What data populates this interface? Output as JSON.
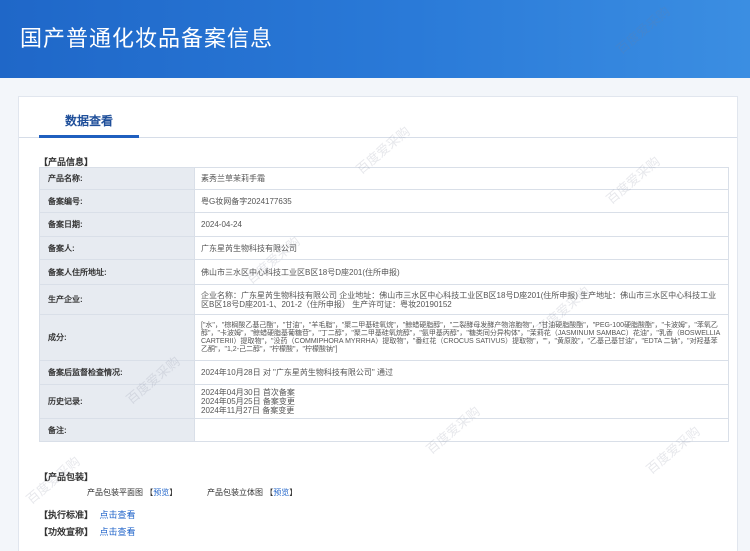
{
  "header": {
    "title": "国产普通化妆品备案信息"
  },
  "tabs": [
    {
      "label": "数据查看"
    }
  ],
  "product_info": {
    "section_label": "【产品信息】",
    "rows": [
      {
        "key": "产品名称:",
        "value": "素秀兰草茉莉手霜"
      },
      {
        "key": "备案编号:",
        "value": "粤G妆网备字2024177635"
      },
      {
        "key": "备案日期:",
        "value": "2024-04-24"
      },
      {
        "key": "备案人:",
        "value": "广东星芮生物科技有限公司"
      },
      {
        "key": "备案人住所地址:",
        "value": "佛山市三水区中心科技工业区B区18号D座201(住所申报)"
      },
      {
        "key": "生产企业:",
        "value": "企业名称：广东星芮生物科技有限公司 企业地址：佛山市三水区中心科技工业区B区18号D座201(住所申报) 生产地址：佛山市三水区中心科技工业区B区18号D座201-1、201-2（住所申报） 生产许可证：粤妆20190152"
      },
      {
        "key": "成分:",
        "value": "[\"水\"，\"棕榈酸乙基己酯\"，\"甘油\"，\"羊毛脂\"，\"聚二甲基硅氧烷\"，\"鲸蜡硬脂醇\"，\"二裂酵母发酵产物溶胞物\"，\"甘油硬脂酸酯\"，\"PEG-100硬脂酸酯\"，\"卡波姆\"，\"苯氧乙醇\"，\"卡波姆\"，\"鲸蜡硬脂基葡糖苷\"，\"丁二醇\"，\"聚二甲基硅氧烷醇\"，\"氨甲基丙醇\"，\"糖类同分异构体\"，\"茉莉花（JASMINUM SAMBAC）花油\"，\"乳香（BOSWELLIA CARTERII）提取物\"，\"没药（COMMIPHORA MYRRHA）提取物\"，\"番红花（CROCUS SATIVUS）提取物\"，\"\"，\"黄原胶\"，\"乙基己基甘油\"，\"EDTA 二钠\"，\"对羟基苯乙酮\"，\"1,2-己二醇\"，\"柠檬酸\"，\"柠檬酸钠\"]"
      },
      {
        "key": "备案后监督检查情况:",
        "value": "2024年10月28日 对 \"广东星芮生物科技有限公司\" 通过"
      },
      {
        "key": "历史记录:",
        "lines": [
          "2024年04月30日 首次备案",
          "2024年05月25日 备案变更",
          "2024年11月27日 备案变更"
        ]
      },
      {
        "key": "备注:",
        "value": ""
      }
    ]
  },
  "packaging": {
    "section_label": "【产品包装】",
    "items": [
      {
        "label": "产品包装平面图",
        "link": "预览"
      },
      {
        "label": "产品包装立体图",
        "link": "预览"
      }
    ]
  },
  "standard": {
    "section_label": "【执行标准】",
    "link": "点击查看"
  },
  "efficacy": {
    "section_label": "【功效宣称】",
    "link": "点击查看"
  },
  "watermark": {
    "text": "百度爱采购"
  }
}
